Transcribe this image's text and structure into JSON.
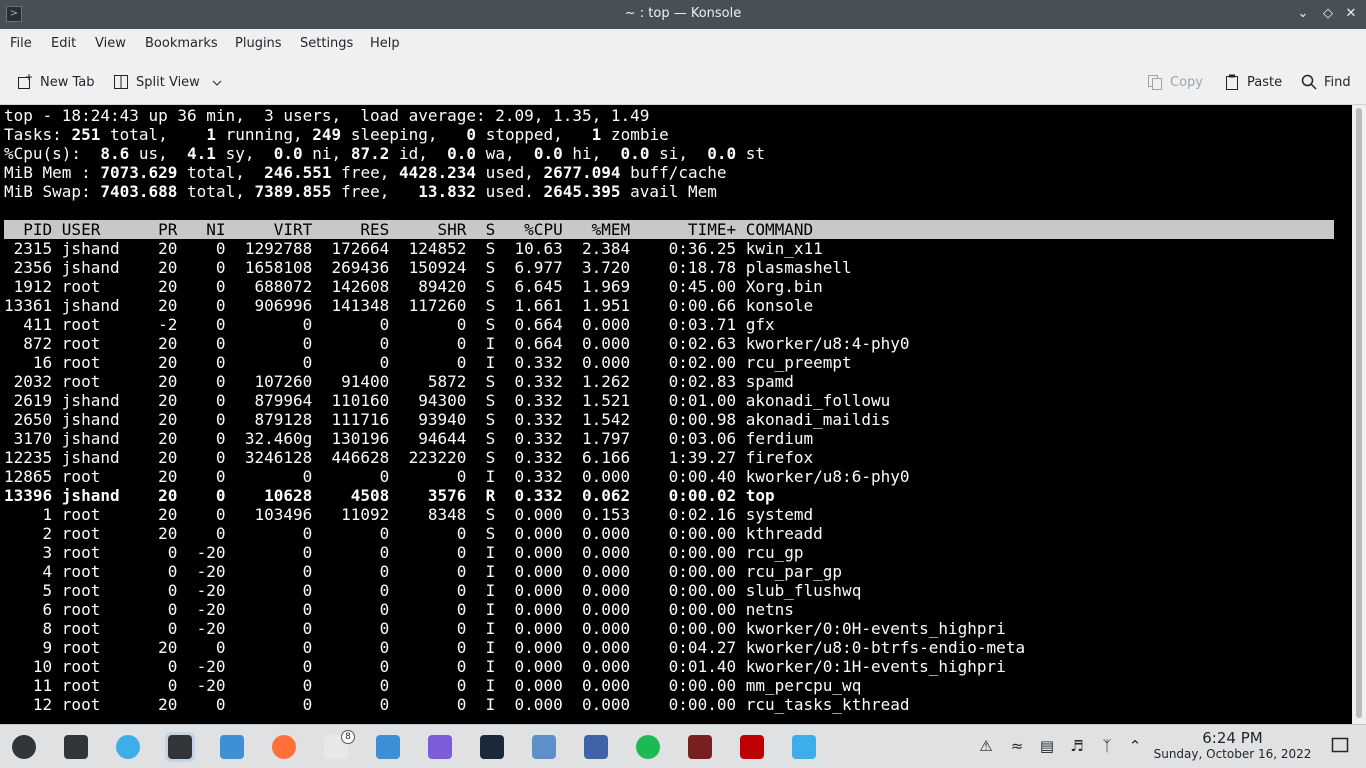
{
  "window": {
    "title": "~ : top — Konsole"
  },
  "menu": [
    "File",
    "Edit",
    "View",
    "Bookmarks",
    "Plugins",
    "Settings",
    "Help"
  ],
  "toolbar": {
    "new_tab": "New Tab",
    "split_view": "Split View",
    "copy": "Copy",
    "paste": "Paste",
    "find": "Find"
  },
  "summary": {
    "l1": "top - 18:24:43 up 36 min,  3 users,  load average: 2.09, 1.35, 1.49",
    "tasks": {
      "label": "Tasks:",
      "total": "251",
      "running": "1",
      "sleeping": "249",
      "stopped": "0",
      "zombie": "1"
    },
    "cpu": {
      "label": "%Cpu(s):",
      "us": "8.6",
      "sy": "4.1",
      "ni": "0.0",
      "id": "87.2",
      "wa": "0.0",
      "hi": "0.0",
      "si": "0.0",
      "st": "0.0"
    },
    "mem": {
      "label": "MiB Mem :",
      "total": "7073.629",
      "free": "246.551",
      "used": "4428.234",
      "buff": "2677.094"
    },
    "swap": {
      "label": "MiB Swap:",
      "total": "7403.688",
      "free": "7389.855",
      "used": "13.832",
      "avail": "2645.395"
    }
  },
  "columns": [
    "PID",
    "USER",
    "PR",
    "NI",
    "VIRT",
    "RES",
    "SHR",
    "S",
    "%CPU",
    "%MEM",
    "TIME+",
    "COMMAND"
  ],
  "processes": [
    [
      "2315",
      "jshand",
      "20",
      "0",
      "1292788",
      "172664",
      "124852",
      "S",
      "10.63",
      "2.384",
      "0:36.25",
      "kwin_x11"
    ],
    [
      "2356",
      "jshand",
      "20",
      "0",
      "1658108",
      "269436",
      "150924",
      "S",
      "6.977",
      "3.720",
      "0:18.78",
      "plasmashell"
    ],
    [
      "1912",
      "root",
      "20",
      "0",
      "688072",
      "142608",
      "89420",
      "S",
      "6.645",
      "1.969",
      "0:45.00",
      "Xorg.bin"
    ],
    [
      "13361",
      "jshand",
      "20",
      "0",
      "906996",
      "141348",
      "117260",
      "S",
      "1.661",
      "1.951",
      "0:00.66",
      "konsole"
    ],
    [
      "411",
      "root",
      "-2",
      "0",
      "0",
      "0",
      "0",
      "S",
      "0.664",
      "0.000",
      "0:03.71",
      "gfx"
    ],
    [
      "872",
      "root",
      "20",
      "0",
      "0",
      "0",
      "0",
      "I",
      "0.664",
      "0.000",
      "0:02.63",
      "kworker/u8:4-phy0"
    ],
    [
      "16",
      "root",
      "20",
      "0",
      "0",
      "0",
      "0",
      "I",
      "0.332",
      "0.000",
      "0:02.00",
      "rcu_preempt"
    ],
    [
      "2032",
      "root",
      "20",
      "0",
      "107260",
      "91400",
      "5872",
      "S",
      "0.332",
      "1.262",
      "0:02.83",
      "spamd"
    ],
    [
      "2619",
      "jshand",
      "20",
      "0",
      "879964",
      "110160",
      "94300",
      "S",
      "0.332",
      "1.521",
      "0:01.00",
      "akonadi_followu"
    ],
    [
      "2650",
      "jshand",
      "20",
      "0",
      "879128",
      "111716",
      "93940",
      "S",
      "0.332",
      "1.542",
      "0:00.98",
      "akonadi_maildis"
    ],
    [
      "3170",
      "jshand",
      "20",
      "0",
      "32.460g",
      "130196",
      "94644",
      "S",
      "0.332",
      "1.797",
      "0:03.06",
      "ferdium"
    ],
    [
      "12235",
      "jshand",
      "20",
      "0",
      "3246128",
      "446628",
      "223220",
      "S",
      "0.332",
      "6.166",
      "1:39.27",
      "firefox"
    ],
    [
      "12865",
      "root",
      "20",
      "0",
      "0",
      "0",
      "0",
      "I",
      "0.332",
      "0.000",
      "0:00.40",
      "kworker/u8:6-phy0"
    ],
    [
      "13396",
      "jshand",
      "20",
      "0",
      "10628",
      "4508",
      "3576",
      "R",
      "0.332",
      "0.062",
      "0:00.02",
      "top"
    ],
    [
      "1",
      "root",
      "20",
      "0",
      "103496",
      "11092",
      "8348",
      "S",
      "0.000",
      "0.153",
      "0:02.16",
      "systemd"
    ],
    [
      "2",
      "root",
      "20",
      "0",
      "0",
      "0",
      "0",
      "S",
      "0.000",
      "0.000",
      "0:00.00",
      "kthreadd"
    ],
    [
      "3",
      "root",
      "0",
      "-20",
      "0",
      "0",
      "0",
      "I",
      "0.000",
      "0.000",
      "0:00.00",
      "rcu_gp"
    ],
    [
      "4",
      "root",
      "0",
      "-20",
      "0",
      "0",
      "0",
      "I",
      "0.000",
      "0.000",
      "0:00.00",
      "rcu_par_gp"
    ],
    [
      "5",
      "root",
      "0",
      "-20",
      "0",
      "0",
      "0",
      "I",
      "0.000",
      "0.000",
      "0:00.00",
      "slub_flushwq"
    ],
    [
      "6",
      "root",
      "0",
      "-20",
      "0",
      "0",
      "0",
      "I",
      "0.000",
      "0.000",
      "0:00.00",
      "netns"
    ],
    [
      "8",
      "root",
      "0",
      "-20",
      "0",
      "0",
      "0",
      "I",
      "0.000",
      "0.000",
      "0:00.00",
      "kworker/0:0H-events_highpri"
    ],
    [
      "9",
      "root",
      "20",
      "0",
      "0",
      "0",
      "0",
      "I",
      "0.000",
      "0.000",
      "0:04.27",
      "kworker/u8:0-btrfs-endio-meta"
    ],
    [
      "10",
      "root",
      "0",
      "-20",
      "0",
      "0",
      "0",
      "I",
      "0.000",
      "0.000",
      "0:01.40",
      "kworker/0:1H-events_highpri"
    ],
    [
      "11",
      "root",
      "0",
      "-20",
      "0",
      "0",
      "0",
      "I",
      "0.000",
      "0.000",
      "0:00.00",
      "mm_percpu_wq"
    ],
    [
      "12",
      "root",
      "20",
      "0",
      "0",
      "0",
      "0",
      "I",
      "0.000",
      "0.000",
      "0:00.00",
      "rcu_tasks_kthread"
    ]
  ],
  "highlight_pid": "13396",
  "taskbar": {
    "apps": [
      "app-launcher-icon",
      "system-settings-toggles-icon",
      "kde-mascot-icon",
      "konsole-icon",
      "dolphin-files-icon",
      "firefox-icon",
      "mail-notification-icon",
      "chat-icon",
      "ferdium-icon",
      "steam-icon",
      "settings-gear-icon",
      "game-box-icon",
      "spotify-icon",
      "wine-icon",
      "filezilla-icon",
      "downloader-icon"
    ],
    "badge": "8",
    "clock_time": "6:24 PM",
    "clock_date": "Sunday, October 16, 2022"
  }
}
